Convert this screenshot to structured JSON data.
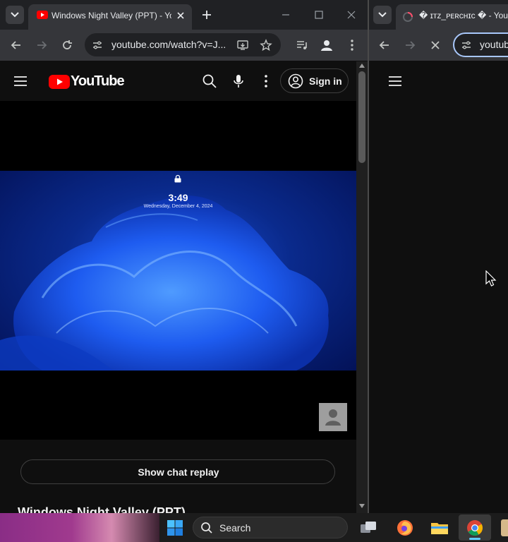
{
  "left_window": {
    "tab_title": "Windows Night Valley (PPT) - YouTube",
    "url": "youtube.com/watch?v=J...",
    "youtube_wordmark": "YouTube",
    "sign_in_label": "Sign in",
    "video_overlay_time": "3:49",
    "video_overlay_date": "Wednesday, December 4, 2024",
    "chat_replay_label": "Show chat replay",
    "video_title": "Windows Night Valley (PPT)"
  },
  "right_window": {
    "tab_title": "� ɪᴛᴢ_ᴘᴇʀᴄʜɪᴄ � - YouTube",
    "url": "youtub"
  },
  "taskbar": {
    "search_label": "Search"
  },
  "colors": {
    "youtube_red": "#ff0000",
    "chrome_dark": "#202124",
    "toolbar": "#35363a",
    "page_bg": "#0f0f0f"
  }
}
